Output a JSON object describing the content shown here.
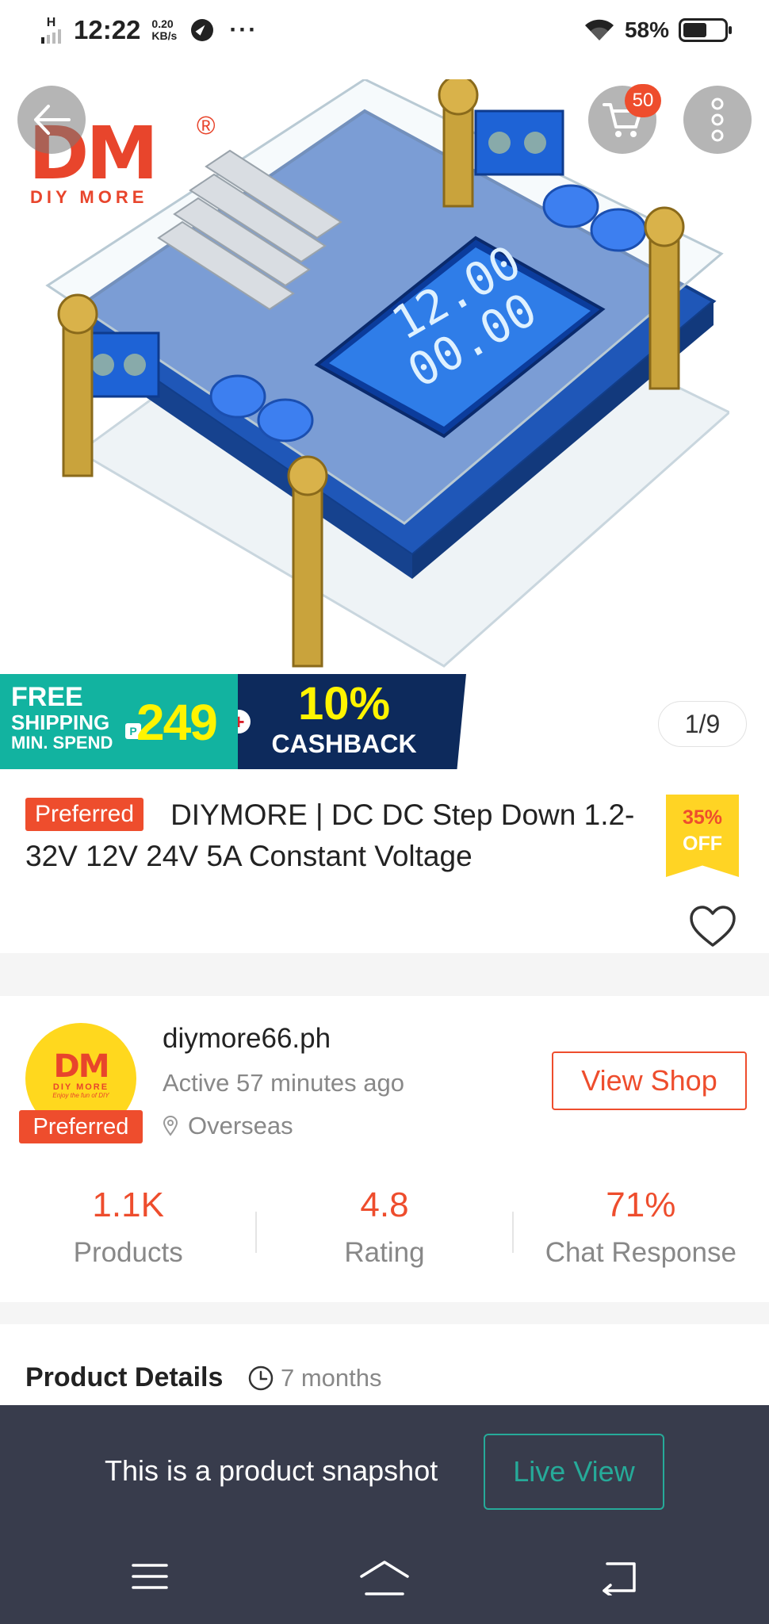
{
  "status_bar": {
    "network": "H",
    "time": "12:22",
    "speed_value": "0.20",
    "speed_unit": "KB/s",
    "more": "···",
    "battery_pct": "58%",
    "battery_level": 0.58
  },
  "hero": {
    "brand_mark": "DM",
    "brand_reg": "®",
    "brand_sub": "DIY MORE",
    "cart_count": "50",
    "page_indicator": "1/9",
    "icons": [
      "back-arrow-icon",
      "cart-icon",
      "more-vertical-icon"
    ]
  },
  "promo": {
    "free": "FREE",
    "shipping": "SHIPPING",
    "min_spend": "MIN. SPEND",
    "currency": "P",
    "amount": "249",
    "plus": "+",
    "percent": "10%",
    "cashback": "CASHBACK"
  },
  "product": {
    "preferred_label": "Preferred",
    "title": "DIYMORE | DC DC Step Down 1.2-32V 12V 24V 5A Constant Voltage",
    "discount_pct": "35%",
    "discount_off": "OFF"
  },
  "shop": {
    "avatar_mark": "DM",
    "avatar_sub": "DIY MORE",
    "avatar_tagline": "Enjoy the fun of DIY",
    "preferred_label": "Preferred",
    "name": "diymore66.ph",
    "active": "Active 57 minutes ago",
    "location": "Overseas",
    "view_shop": "View Shop",
    "stats": [
      {
        "value": "1.1K",
        "label": "Products"
      },
      {
        "value": "4.8",
        "label": "Rating"
      },
      {
        "value": "71%",
        "label": "Chat Response"
      }
    ]
  },
  "details": {
    "title": "Product Details",
    "age": "7 months"
  },
  "snapshot": {
    "text": "This is a product snapshot",
    "live_view": "Live View"
  },
  "colors": {
    "accent": "#ee4d2d",
    "teal": "#26aa99",
    "snapshot_bg": "#383c4c",
    "discount_bg": "#ffd424"
  }
}
